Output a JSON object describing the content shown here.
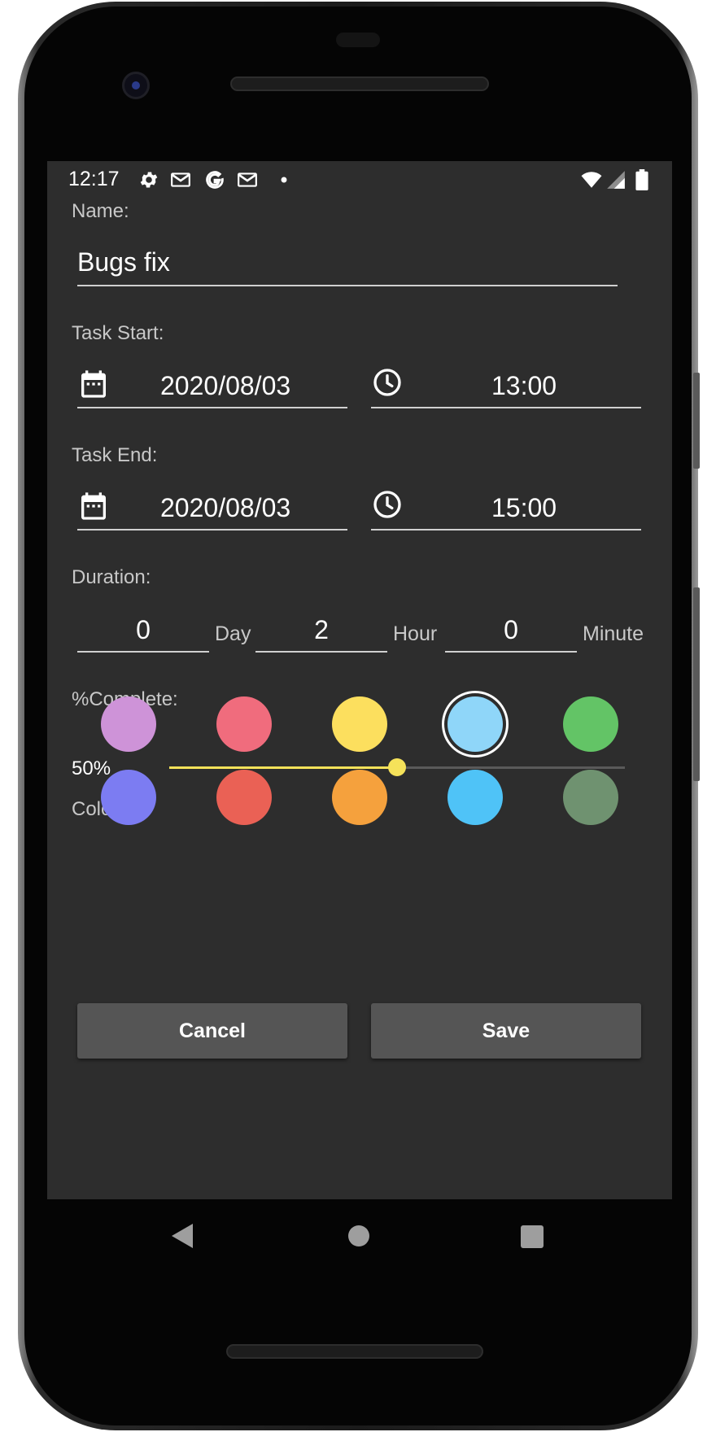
{
  "status_bar": {
    "time": "12:17",
    "left_icons": [
      "gear-icon",
      "gmail-icon",
      "google-icon",
      "gmail-icon",
      "notification-dot-icon"
    ],
    "right_icons": [
      "wifi-icon",
      "signal-icon",
      "battery-icon"
    ]
  },
  "form": {
    "name_label": "Name:",
    "name_value": "Bugs fix",
    "task_start_label": "Task Start:",
    "start_date": "2020/08/03",
    "start_time": "13:00",
    "task_end_label": "Task End:",
    "end_date": "2020/08/03",
    "end_time": "15:00",
    "duration_label": "Duration:",
    "duration": {
      "days": "0",
      "day_unit": "Day",
      "hours": "2",
      "hour_unit": "Hour",
      "minutes": "0",
      "minute_unit": "Minute"
    },
    "complete_label": "%Complete:",
    "complete_value_text": "50%",
    "complete_fraction": 0.5,
    "color_label": "Color:",
    "colors": [
      "#ce93d8",
      "#f06c7d",
      "#fcdf5e",
      "#8fd6f9",
      "#63c466",
      "#7c7cf2",
      "#ea6155",
      "#f5a13d",
      "#4fc3f7",
      "#6f9270"
    ],
    "selected_color_index": 3
  },
  "buttons": {
    "cancel": "Cancel",
    "save": "Save"
  },
  "accent_color": "#f5e25a"
}
